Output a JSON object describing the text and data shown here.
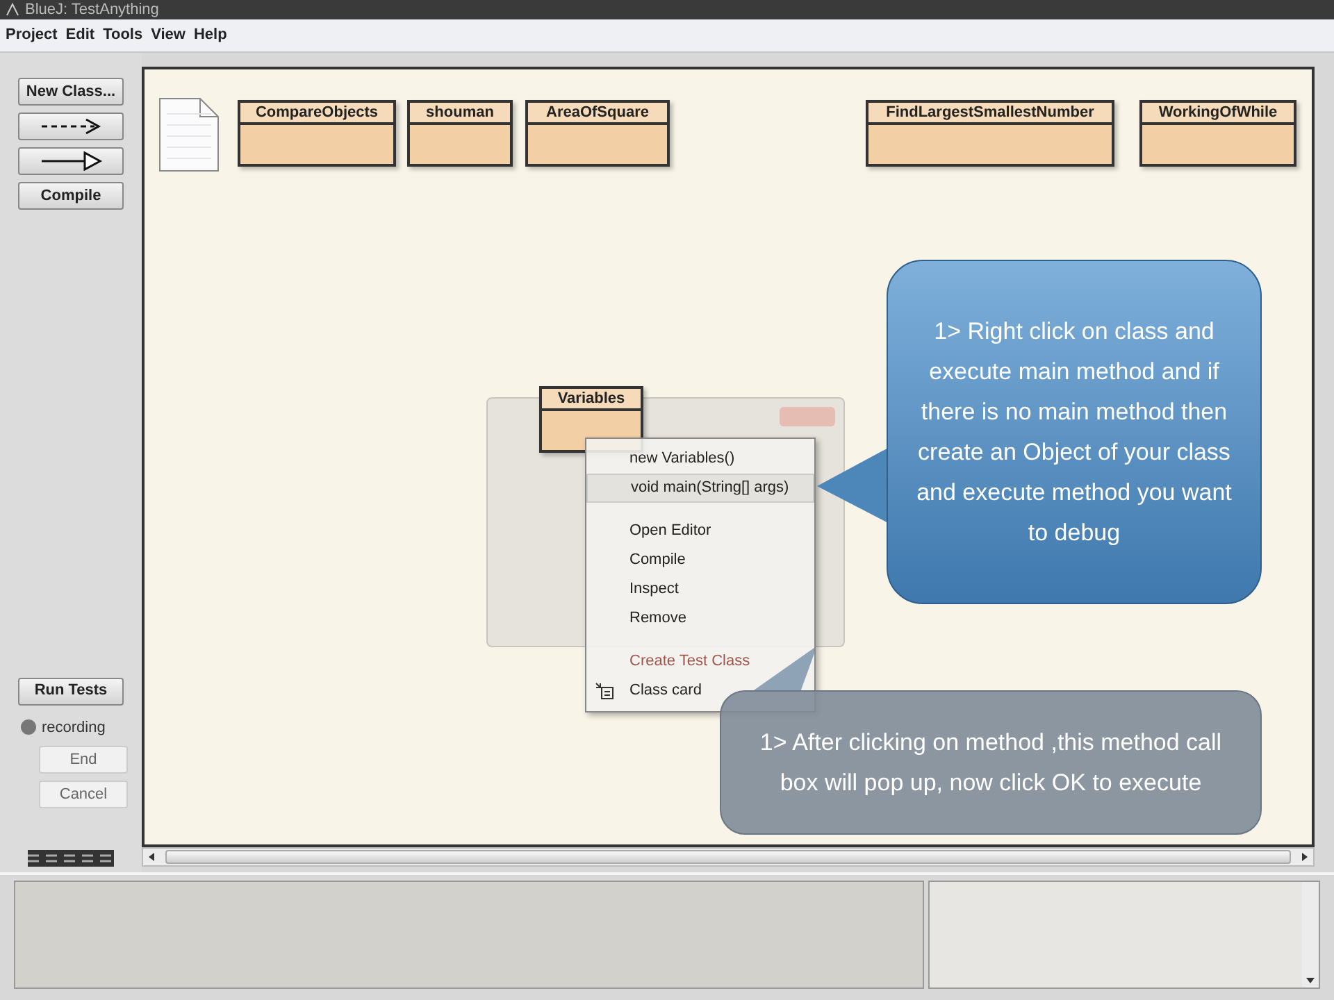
{
  "window": {
    "title": "BlueJ: TestAnything"
  },
  "menu": [
    "Project",
    "Edit",
    "Tools",
    "View",
    "Help"
  ],
  "toolbar": [
    {
      "kind": "text",
      "label": "New Class..."
    },
    {
      "kind": "dashed-arrow"
    },
    {
      "kind": "solid-arrow"
    },
    {
      "kind": "text",
      "label": "Compile"
    }
  ],
  "test_panel": {
    "run_tests": "Run Tests",
    "recording": {
      "label": "recording",
      "on": false
    },
    "end": {
      "label": "End",
      "disabled": true
    },
    "cancel": {
      "label": "Cancel",
      "disabled": true
    }
  },
  "classes": [
    "CompareObjects",
    "shouman",
    "AreaOfSquare",
    "FindLargestSmallestNumber",
    "WorkingOfWhile",
    "Variables"
  ],
  "method_dialog": {
    "visible": true
  },
  "context_menu": [
    {
      "kind": "item",
      "label": "new Variables()",
      "selected": false
    },
    {
      "kind": "item",
      "label": "void main(String[] args)",
      "selected": true
    },
    {
      "kind": "separator"
    },
    {
      "kind": "item",
      "label": "Open Editor",
      "selected": false
    },
    {
      "kind": "item",
      "label": "Compile",
      "selected": false
    },
    {
      "kind": "item",
      "label": "Inspect",
      "selected": false
    },
    {
      "kind": "item",
      "label": "Remove",
      "selected": false
    },
    {
      "kind": "separator"
    },
    {
      "kind": "test",
      "label": "Create Test Class",
      "selected": false
    },
    {
      "kind": "card",
      "label": "Class card",
      "selected": false
    }
  ],
  "callouts": [
    {
      "kind": "blue",
      "text": "1> Right click on class and execute main method and if there is no main method then create an Object of your class and execute method you want to debug"
    },
    {
      "kind": "grey",
      "text": "1> After clicking on method ,this method call box will pop up, now click OK to execute"
    }
  ]
}
